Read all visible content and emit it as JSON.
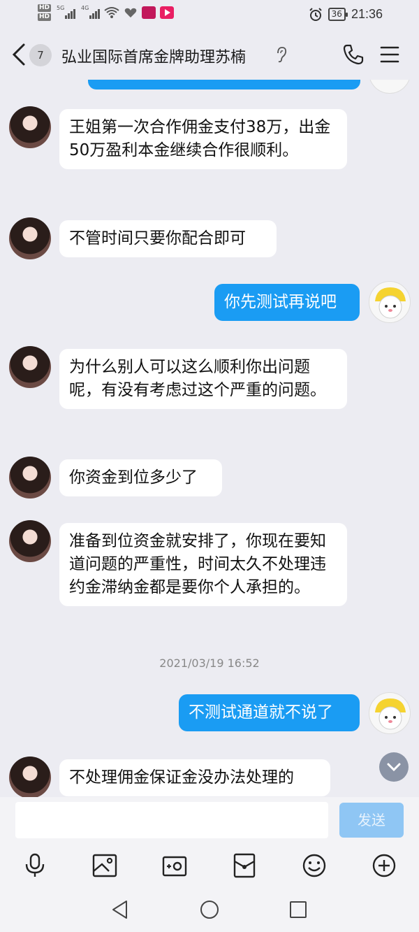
{
  "status_bar": {
    "hd1": "HD",
    "hd2": "HD",
    "net1": "5G",
    "net2": "4G",
    "battery": "36",
    "time": "21:36"
  },
  "header": {
    "unread_count": "7",
    "title": "弘业国际首席金牌助理苏楠"
  },
  "messages": [
    {
      "side": "left",
      "text": "王姐第一次合作佣金支付38万，出金50万盈利本金继续合作很顺利。"
    },
    {
      "side": "left",
      "text": "不管时间只要你配合即可"
    },
    {
      "side": "right",
      "text": "你先测试再说吧"
    },
    {
      "side": "left",
      "text": "为什么别人可以这么顺利你出问题呢，有没有考虑过这个严重的问题。"
    },
    {
      "side": "left",
      "text": "你资金到位多少了"
    },
    {
      "side": "left",
      "text": "准备到位资金就安排了，你现在要知道问题的严重性，时间太久不处理违约金滞纳金都是要你个人承担的。"
    },
    {
      "side": "right",
      "text": "不测试通道就不说了"
    },
    {
      "side": "left",
      "text": "不处理佣金保证金没办法处理的"
    }
  ],
  "timestamp": "2021/03/19 16:52",
  "input": {
    "placeholder": "",
    "send_label": "发送"
  },
  "colors": {
    "accent": "#1a9cf3",
    "background": "#ececf2"
  },
  "icons": [
    "back-arrow-icon",
    "ear-icon",
    "phone-icon",
    "menu-icon",
    "mic-icon",
    "image-icon",
    "camera-icon",
    "red-packet-icon",
    "emoji-icon",
    "plus-icon",
    "nav-back-icon",
    "nav-home-icon",
    "nav-recent-icon"
  ]
}
